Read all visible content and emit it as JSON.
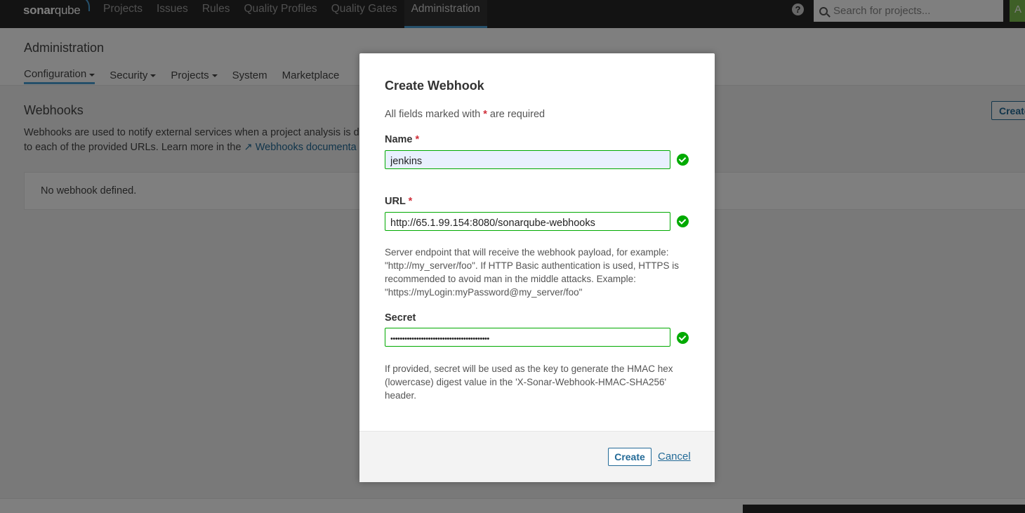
{
  "topnav": {
    "logo_bold": "sonar",
    "logo_light": "qube",
    "items": [
      {
        "label": "Projects"
      },
      {
        "label": "Issues"
      },
      {
        "label": "Rules"
      },
      {
        "label": "Quality Profiles"
      },
      {
        "label": "Quality Gates"
      },
      {
        "label": "Administration"
      }
    ],
    "help_label": "?",
    "search_placeholder": "Search for projects...",
    "avatar_label": "A"
  },
  "page": {
    "title": "Administration",
    "tabs": [
      {
        "label": "Configuration"
      },
      {
        "label": "Security"
      },
      {
        "label": "Projects"
      },
      {
        "label": "System"
      },
      {
        "label": "Marketplace"
      }
    ]
  },
  "webhooks": {
    "title": "Webhooks",
    "desc_line1": "Webhooks are used to notify external services when a project analysis is d",
    "desc_line2": "to each of the provided URLs. Learn more in the",
    "doc_link": "Webhooks documenta",
    "create_label": "Create",
    "empty_text": "No webhook defined."
  },
  "modal": {
    "title": "Create Webhook",
    "required_prefix": "All fields marked with",
    "required_star": "*",
    "required_suffix": "are required",
    "name_label": "Name",
    "name_value": "jenkins",
    "url_label": "URL",
    "url_value": "http://65.1.99.154:8080/sonarqube-webhooks",
    "url_help": "Server endpoint that will receive the webhook payload, for example: \"http://my_server/foo\". If HTTP Basic authentication is used, HTTPS is recommended to avoid man in the middle attacks. Example: \"https://myLogin:myPassword@my_server/foo\"",
    "secret_label": "Secret",
    "secret_value": "••••••••••••••••••••••••••••••••••••••••••",
    "secret_help": "If provided, secret will be used as the key to generate the HMAC hex (lowercase) digest value in the 'X-Sonar-Webhook-HMAC-SHA256' header.",
    "create_button": "Create",
    "cancel_button": "Cancel"
  },
  "colors": {
    "accent": "#236a97",
    "valid": "#00aa00",
    "required": "#d02f3a",
    "topbar": "#262626"
  }
}
